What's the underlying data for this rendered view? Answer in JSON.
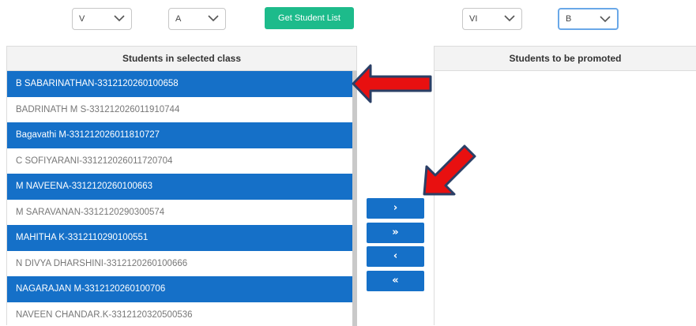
{
  "filters": {
    "from_standard": "V",
    "from_section": "A",
    "get_list_label": "Get Student List",
    "to_standard": "VI",
    "to_section": "B"
  },
  "left_panel": {
    "title": "Students in selected class",
    "students": [
      {
        "label": "B SABARINATHAN-3312120260100658",
        "selected": true
      },
      {
        "label": "BADRINATH M S-331212026011910744",
        "selected": false
      },
      {
        "label": "Bagavathi M-331212026011810727",
        "selected": true
      },
      {
        "label": "C SOFIYARANI-331212026011720704",
        "selected": false
      },
      {
        "label": "M NAVEENA-3312120260100663",
        "selected": true
      },
      {
        "label": "M SARAVANAN-3312120290300574",
        "selected": false
      },
      {
        "label": "MAHITHA K-3312110290100551",
        "selected": true
      },
      {
        "label": "N DIVYA DHARSHINI-3312120260100666",
        "selected": false
      },
      {
        "label": "NAGARAJAN M-3312120260100706",
        "selected": true
      },
      {
        "label": "NAVEEN CHANDAR.K-3312120320500536",
        "selected": false
      }
    ]
  },
  "right_panel": {
    "title": "Students to be promoted"
  },
  "move_buttons": {
    "move_selected": "›",
    "move_all": "»",
    "remove_selected": "‹",
    "remove_all": "«"
  },
  "colors": {
    "accent_blue": "#1570c8",
    "green_button": "#1dbb8b",
    "annotation_red": "#e81010"
  }
}
